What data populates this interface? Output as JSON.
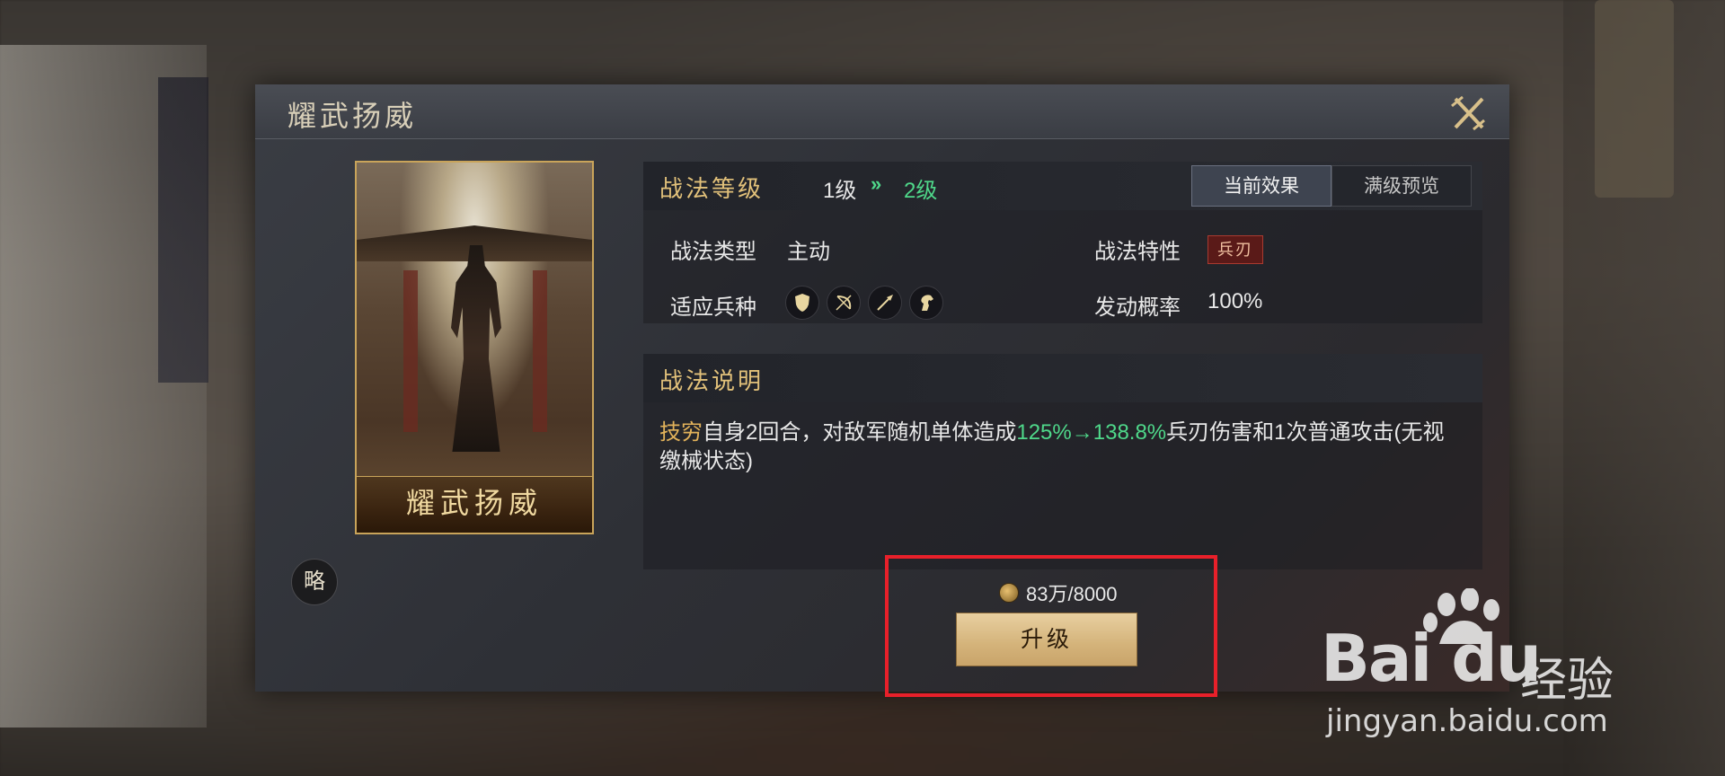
{
  "dialog": {
    "title": "耀武扬威",
    "close_icon": "close-x-icon"
  },
  "card": {
    "name": "耀武扬威",
    "badge": "略"
  },
  "level": {
    "label": "战法等级",
    "current": "1级",
    "arrow": "»",
    "next": "2级",
    "tabs": [
      "当前效果",
      "满级预览"
    ],
    "active_tab": "当前效果"
  },
  "attributes": {
    "type_label": "战法类型",
    "type_value": "主动",
    "trait_label": "战法特性",
    "trait_value": "兵刃",
    "unit_label": "适应兵种",
    "unit_icons": [
      "shield-icon",
      "bow-icon",
      "spear-icon",
      "horse-icon"
    ],
    "rate_label": "发动概率",
    "rate_value": "100%"
  },
  "description": {
    "label": "战法说明",
    "part1": "技穷",
    "part2": "自身2回合，对敌军随机单体造成",
    "part3": "125%→138.8%",
    "part4": "兵刃伤害和1次普通攻击(无视缴械状态)"
  },
  "upgrade": {
    "cost": "83万/8000",
    "button": "升级"
  },
  "colors": {
    "accent_gold": "#e2c17a",
    "accent_green": "#4fd88a",
    "highlight_red": "#e8202a"
  },
  "watermark": {
    "logo": "Bai du",
    "text": "经验",
    "url": "jingyan.baidu.com"
  }
}
